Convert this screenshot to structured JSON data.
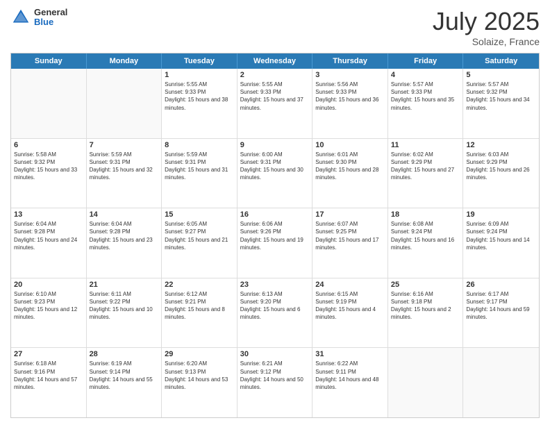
{
  "header": {
    "logo_general": "General",
    "logo_blue": "Blue",
    "title": "July 2025",
    "location": "Solaize, France"
  },
  "days_of_week": [
    "Sunday",
    "Monday",
    "Tuesday",
    "Wednesday",
    "Thursday",
    "Friday",
    "Saturday"
  ],
  "weeks": [
    [
      {
        "day": "",
        "empty": true
      },
      {
        "day": "",
        "empty": true
      },
      {
        "day": "1",
        "sunrise": "Sunrise: 5:55 AM",
        "sunset": "Sunset: 9:33 PM",
        "daylight": "Daylight: 15 hours and 38 minutes."
      },
      {
        "day": "2",
        "sunrise": "Sunrise: 5:55 AM",
        "sunset": "Sunset: 9:33 PM",
        "daylight": "Daylight: 15 hours and 37 minutes."
      },
      {
        "day": "3",
        "sunrise": "Sunrise: 5:56 AM",
        "sunset": "Sunset: 9:33 PM",
        "daylight": "Daylight: 15 hours and 36 minutes."
      },
      {
        "day": "4",
        "sunrise": "Sunrise: 5:57 AM",
        "sunset": "Sunset: 9:33 PM",
        "daylight": "Daylight: 15 hours and 35 minutes."
      },
      {
        "day": "5",
        "sunrise": "Sunrise: 5:57 AM",
        "sunset": "Sunset: 9:32 PM",
        "daylight": "Daylight: 15 hours and 34 minutes."
      }
    ],
    [
      {
        "day": "6",
        "sunrise": "Sunrise: 5:58 AM",
        "sunset": "Sunset: 9:32 PM",
        "daylight": "Daylight: 15 hours and 33 minutes."
      },
      {
        "day": "7",
        "sunrise": "Sunrise: 5:59 AM",
        "sunset": "Sunset: 9:31 PM",
        "daylight": "Daylight: 15 hours and 32 minutes."
      },
      {
        "day": "8",
        "sunrise": "Sunrise: 5:59 AM",
        "sunset": "Sunset: 9:31 PM",
        "daylight": "Daylight: 15 hours and 31 minutes."
      },
      {
        "day": "9",
        "sunrise": "Sunrise: 6:00 AM",
        "sunset": "Sunset: 9:31 PM",
        "daylight": "Daylight: 15 hours and 30 minutes."
      },
      {
        "day": "10",
        "sunrise": "Sunrise: 6:01 AM",
        "sunset": "Sunset: 9:30 PM",
        "daylight": "Daylight: 15 hours and 28 minutes."
      },
      {
        "day": "11",
        "sunrise": "Sunrise: 6:02 AM",
        "sunset": "Sunset: 9:29 PM",
        "daylight": "Daylight: 15 hours and 27 minutes."
      },
      {
        "day": "12",
        "sunrise": "Sunrise: 6:03 AM",
        "sunset": "Sunset: 9:29 PM",
        "daylight": "Daylight: 15 hours and 26 minutes."
      }
    ],
    [
      {
        "day": "13",
        "sunrise": "Sunrise: 6:04 AM",
        "sunset": "Sunset: 9:28 PM",
        "daylight": "Daylight: 15 hours and 24 minutes."
      },
      {
        "day": "14",
        "sunrise": "Sunrise: 6:04 AM",
        "sunset": "Sunset: 9:28 PM",
        "daylight": "Daylight: 15 hours and 23 minutes."
      },
      {
        "day": "15",
        "sunrise": "Sunrise: 6:05 AM",
        "sunset": "Sunset: 9:27 PM",
        "daylight": "Daylight: 15 hours and 21 minutes."
      },
      {
        "day": "16",
        "sunrise": "Sunrise: 6:06 AM",
        "sunset": "Sunset: 9:26 PM",
        "daylight": "Daylight: 15 hours and 19 minutes."
      },
      {
        "day": "17",
        "sunrise": "Sunrise: 6:07 AM",
        "sunset": "Sunset: 9:25 PM",
        "daylight": "Daylight: 15 hours and 17 minutes."
      },
      {
        "day": "18",
        "sunrise": "Sunrise: 6:08 AM",
        "sunset": "Sunset: 9:24 PM",
        "daylight": "Daylight: 15 hours and 16 minutes."
      },
      {
        "day": "19",
        "sunrise": "Sunrise: 6:09 AM",
        "sunset": "Sunset: 9:24 PM",
        "daylight": "Daylight: 15 hours and 14 minutes."
      }
    ],
    [
      {
        "day": "20",
        "sunrise": "Sunrise: 6:10 AM",
        "sunset": "Sunset: 9:23 PM",
        "daylight": "Daylight: 15 hours and 12 minutes."
      },
      {
        "day": "21",
        "sunrise": "Sunrise: 6:11 AM",
        "sunset": "Sunset: 9:22 PM",
        "daylight": "Daylight: 15 hours and 10 minutes."
      },
      {
        "day": "22",
        "sunrise": "Sunrise: 6:12 AM",
        "sunset": "Sunset: 9:21 PM",
        "daylight": "Daylight: 15 hours and 8 minutes."
      },
      {
        "day": "23",
        "sunrise": "Sunrise: 6:13 AM",
        "sunset": "Sunset: 9:20 PM",
        "daylight": "Daylight: 15 hours and 6 minutes."
      },
      {
        "day": "24",
        "sunrise": "Sunrise: 6:15 AM",
        "sunset": "Sunset: 9:19 PM",
        "daylight": "Daylight: 15 hours and 4 minutes."
      },
      {
        "day": "25",
        "sunrise": "Sunrise: 6:16 AM",
        "sunset": "Sunset: 9:18 PM",
        "daylight": "Daylight: 15 hours and 2 minutes."
      },
      {
        "day": "26",
        "sunrise": "Sunrise: 6:17 AM",
        "sunset": "Sunset: 9:17 PM",
        "daylight": "Daylight: 14 hours and 59 minutes."
      }
    ],
    [
      {
        "day": "27",
        "sunrise": "Sunrise: 6:18 AM",
        "sunset": "Sunset: 9:16 PM",
        "daylight": "Daylight: 14 hours and 57 minutes."
      },
      {
        "day": "28",
        "sunrise": "Sunrise: 6:19 AM",
        "sunset": "Sunset: 9:14 PM",
        "daylight": "Daylight: 14 hours and 55 minutes."
      },
      {
        "day": "29",
        "sunrise": "Sunrise: 6:20 AM",
        "sunset": "Sunset: 9:13 PM",
        "daylight": "Daylight: 14 hours and 53 minutes."
      },
      {
        "day": "30",
        "sunrise": "Sunrise: 6:21 AM",
        "sunset": "Sunset: 9:12 PM",
        "daylight": "Daylight: 14 hours and 50 minutes."
      },
      {
        "day": "31",
        "sunrise": "Sunrise: 6:22 AM",
        "sunset": "Sunset: 9:11 PM",
        "daylight": "Daylight: 14 hours and 48 minutes."
      },
      {
        "day": "",
        "empty": true
      },
      {
        "day": "",
        "empty": true
      }
    ]
  ]
}
